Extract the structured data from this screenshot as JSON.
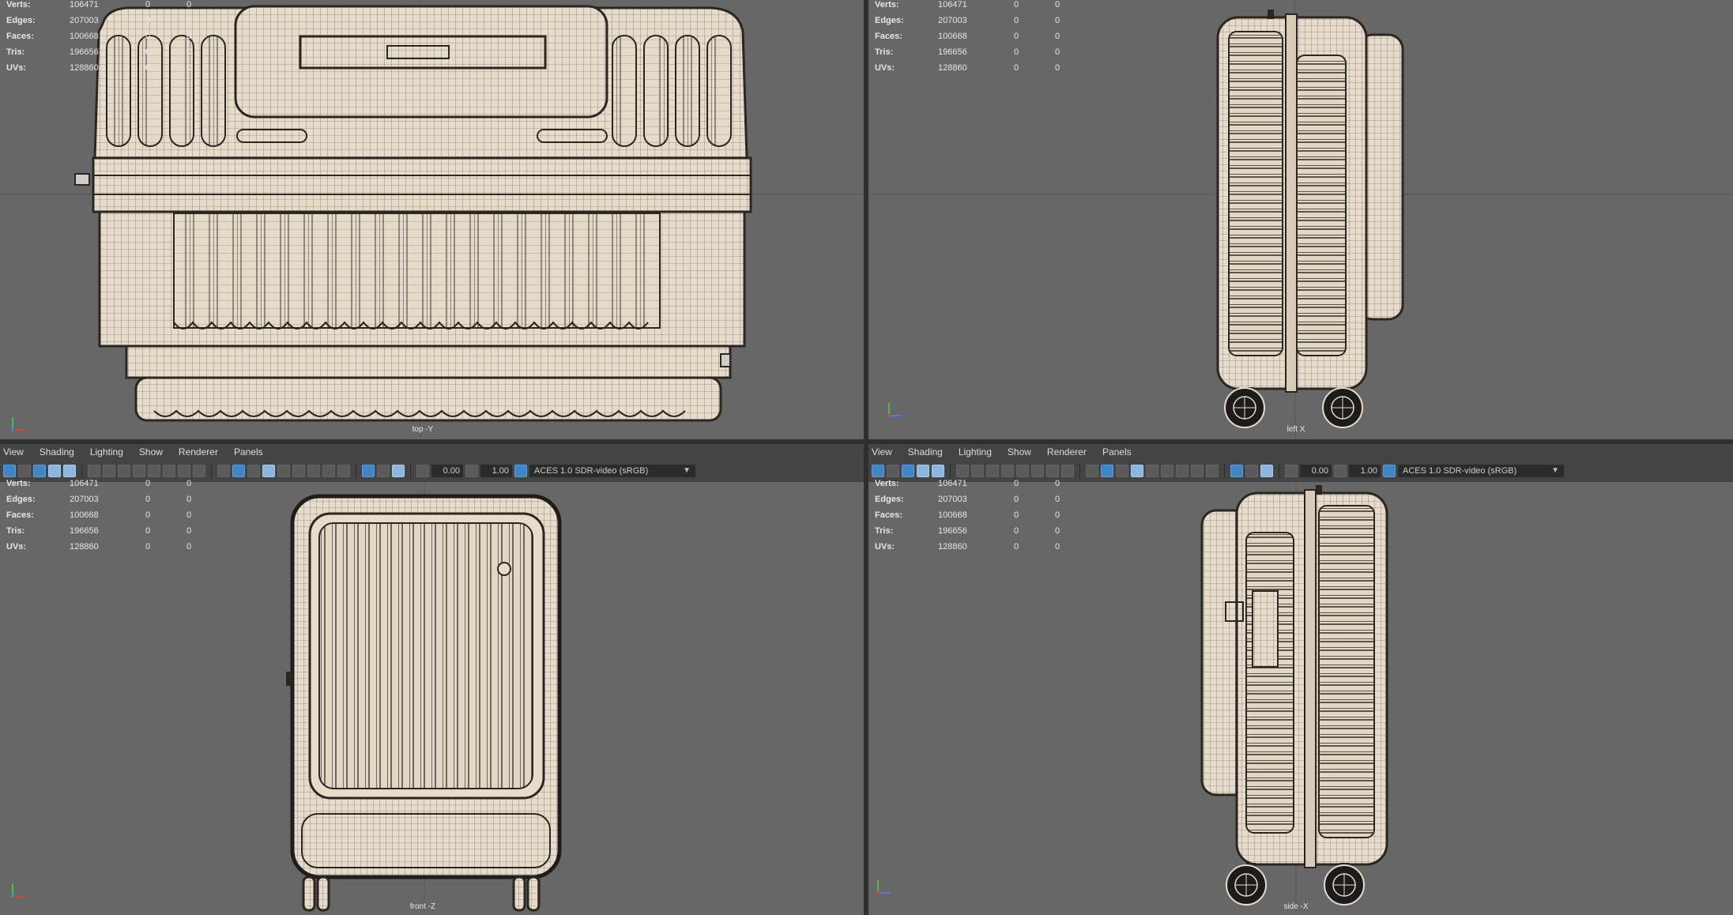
{
  "menu": [
    "View",
    "Shading",
    "Lighting",
    "Show",
    "Renderer",
    "Panels"
  ],
  "stats": {
    "rows": [
      {
        "label": "Verts:",
        "value": "106471",
        "a": "0",
        "b": "0"
      },
      {
        "label": "Edges:",
        "value": "207003",
        "a": "0",
        "b": "0"
      },
      {
        "label": "Faces:",
        "value": "100668",
        "a": "0",
        "b": "0"
      },
      {
        "label": "Tris:",
        "value": "196656",
        "a": "0",
        "b": "0"
      },
      {
        "label": "UVs:",
        "value": "128860",
        "a": "0",
        "b": "0"
      }
    ]
  },
  "toolbar": {
    "exposure": "0.00",
    "gamma": "1.00",
    "color_space": "ACES 1.0 SDR-video (sRGB)"
  },
  "viewports": {
    "top": {
      "label": "top -Y"
    },
    "left": {
      "label": "left X"
    },
    "front": {
      "label": "front -Z"
    },
    "side": {
      "label": "side -X"
    }
  },
  "colors": {
    "viewport_bg": "#676767",
    "model_fill": "#e7dccb",
    "wire": "#3b3630",
    "accent": "#3f86c7"
  }
}
